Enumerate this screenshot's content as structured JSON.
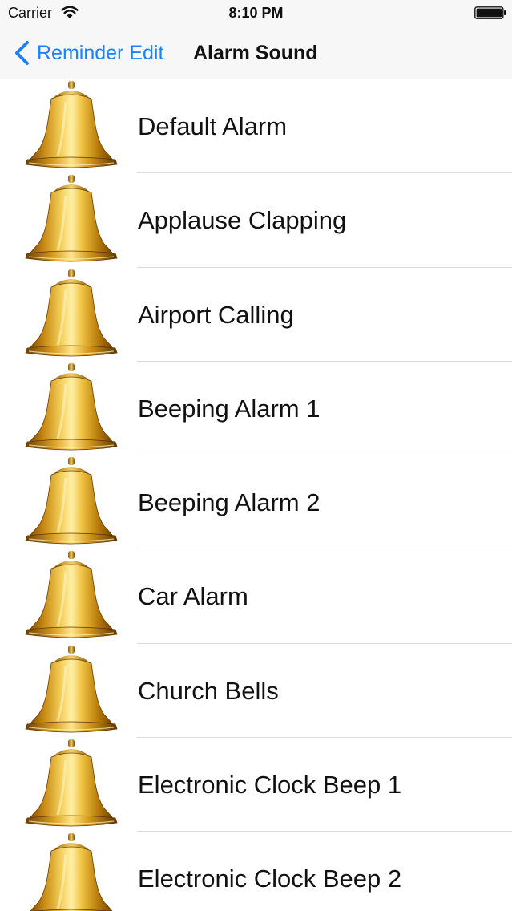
{
  "status_bar": {
    "carrier": "Carrier",
    "time": "8:10 PM",
    "wifi_icon": "wifi-icon",
    "battery_icon": "battery-icon"
  },
  "nav": {
    "back_label": "Reminder Edit",
    "title": "Alarm Sound",
    "accent_color": "#1a82fb"
  },
  "sounds": [
    {
      "label": "Default Alarm",
      "icon": "bell-icon"
    },
    {
      "label": "Applause Clapping",
      "icon": "bell-icon"
    },
    {
      "label": "Airport Calling",
      "icon": "bell-icon"
    },
    {
      "label": "Beeping Alarm 1",
      "icon": "bell-icon"
    },
    {
      "label": "Beeping Alarm 2",
      "icon": "bell-icon"
    },
    {
      "label": "Car Alarm",
      "icon": "bell-icon"
    },
    {
      "label": "Church Bells",
      "icon": "bell-icon"
    },
    {
      "label": "Electronic Clock Beep 1",
      "icon": "bell-icon"
    },
    {
      "label": "Electronic Clock Beep 2",
      "icon": "bell-icon"
    }
  ]
}
